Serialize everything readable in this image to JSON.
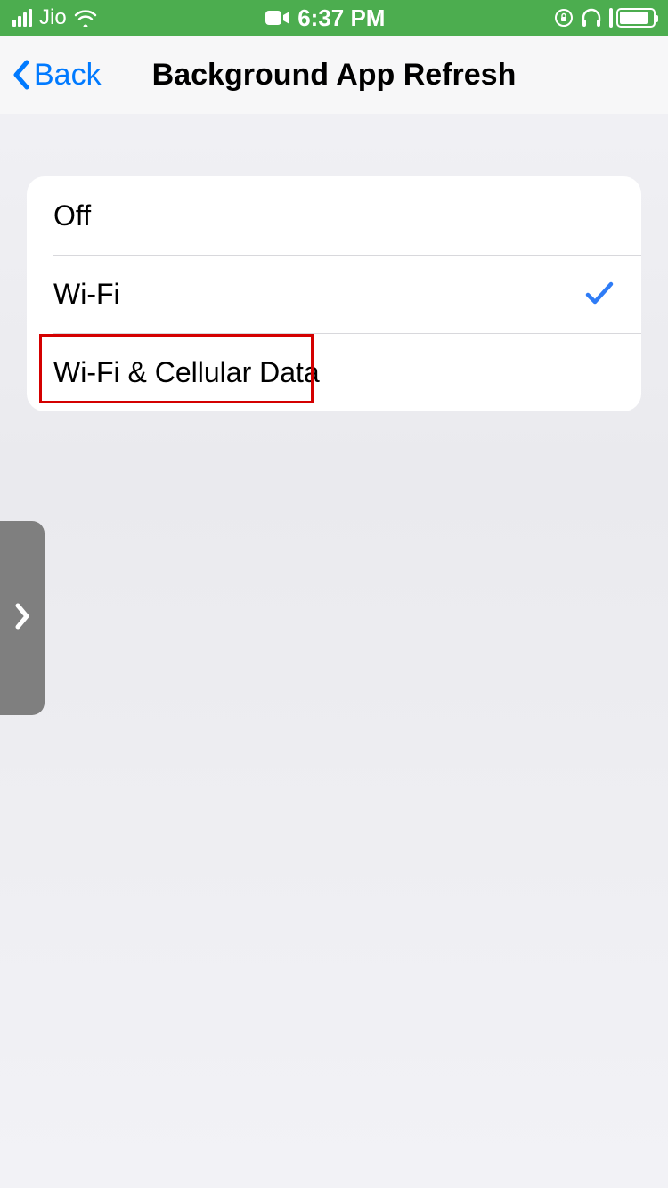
{
  "statusBar": {
    "carrier": "Jio",
    "time": "6:37 PM"
  },
  "nav": {
    "backLabel": "Back",
    "title": "Background App Refresh"
  },
  "options": [
    {
      "label": "Off",
      "selected": false
    },
    {
      "label": "Wi-Fi",
      "selected": true
    },
    {
      "label": "Wi-Fi & Cellular Data",
      "selected": false
    }
  ]
}
